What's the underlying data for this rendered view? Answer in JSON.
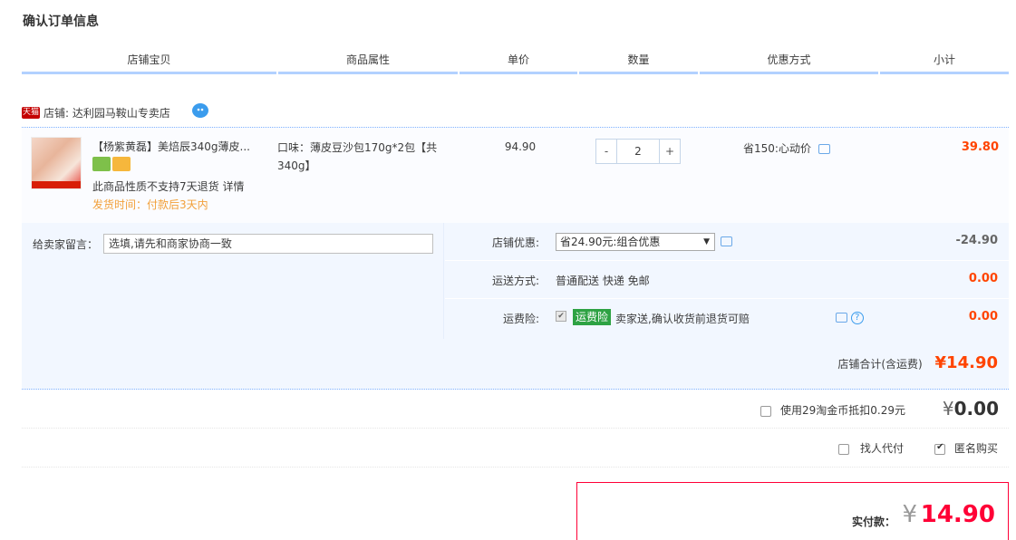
{
  "page_title": "确认订单信息",
  "columns": [
    "店铺宝贝",
    "商品属性",
    "单价",
    "数量",
    "优惠方式",
    "小计"
  ],
  "shop": {
    "badge": "天猫",
    "name": "店铺: 达利园马鞍山专卖店"
  },
  "item": {
    "title": "【杨紫黄磊】美焙辰340g薄皮...",
    "no_return": "此商品性质不支持7天退货 详情",
    "ship_time": "发货时间：付款后3天内",
    "attribute": "口味：薄皮豆沙包170g*2包【共340g】",
    "unit_price": "94.90",
    "qty": "2",
    "qty_minus": "-",
    "qty_plus": "+",
    "promo": "省150:心动价",
    "subtotal": "39.80"
  },
  "message": {
    "label": "给卖家留言：",
    "placeholder": "选填,请先和商家协商一致"
  },
  "shop_discount": {
    "label": "店铺优惠:",
    "selected": "省24.90元:组合优惠",
    "amount": "-24.90"
  },
  "shipping": {
    "label": "运送方式:",
    "value": "普通配送 快递 免邮",
    "amount": "0.00"
  },
  "insurance": {
    "label": "运费险:",
    "badge": "运费险",
    "text": "卖家送,确认收货前退货可赔",
    "amount": "0.00"
  },
  "shop_total": {
    "label": "店铺合计(含运费)",
    "amount": "¥14.90"
  },
  "coin": {
    "label": "使用29淘金币抵扣0.29元",
    "yen": "¥",
    "amount": "0.00"
  },
  "options": {
    "pay_for_me": "找人代付",
    "anonymous": "匿名购买"
  },
  "payment": {
    "label": "实付款：",
    "yen": "¥",
    "amount": "14.90"
  },
  "colors": {
    "accent_red": "#ff0036",
    "price_orange": "#ff4400",
    "header_underline": "#b2d1ff",
    "panel_bg": "#f2f7ff"
  }
}
